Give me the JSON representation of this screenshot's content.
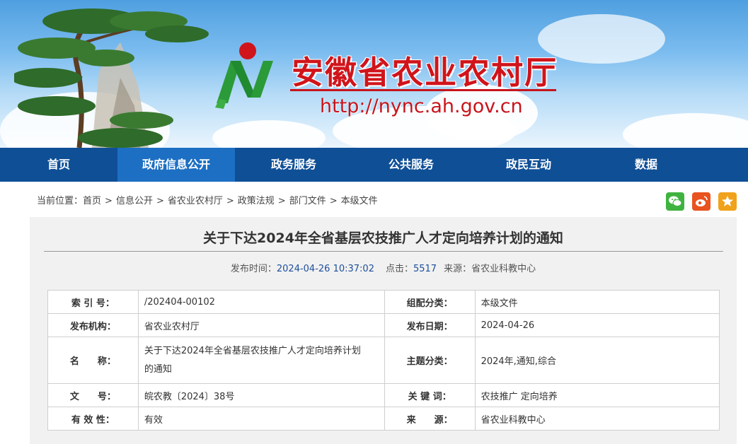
{
  "header": {
    "site_title": "安徽省农业农村厅",
    "site_url": "http://nync.ah.gov.cn",
    "logo_icon": "ministry-logo-icon",
    "colors": {
      "title_red": "#d0141b",
      "nav_blue": "#0f4f96",
      "nav_active": "#1d6fc3"
    }
  },
  "nav": {
    "items": [
      {
        "label": "首页"
      },
      {
        "label": "政府信息公开"
      },
      {
        "label": "政务服务"
      },
      {
        "label": "公共服务"
      },
      {
        "label": "政民互动"
      },
      {
        "label": "数据"
      }
    ],
    "active_index": 1
  },
  "breadcrumb": {
    "prefix": "当前位置：",
    "items": [
      "首页",
      "信息公开",
      "省农业农村厅",
      "政策法规",
      "部门文件",
      "本级文件"
    ],
    "separator": ">"
  },
  "share": {
    "icons": [
      "wechat-icon",
      "weibo-icon",
      "favorite-star-icon"
    ]
  },
  "article": {
    "title": "关于下达2024年全省基层农技推广人才定向培养计划的通知",
    "publish_label": "发布时间：",
    "publish_time": "2024-04-26 10:37:02",
    "clicks_label": "点击：",
    "clicks": "5517",
    "source_label": "来源：",
    "source": "省农业科教中心"
  },
  "info_table": {
    "index_label": "索 引 号：",
    "index_value": "/202404-00102",
    "category_label": "组配分类：",
    "category_value": "本级文件",
    "org_label": "发布机构：",
    "org_value": "省农业农村厅",
    "date_label": "发布日期：",
    "date_value": "2024-04-26",
    "name_label": "名　　称：",
    "name_value_line1": "关于下达2024年全省基层农技推广人才定向培养计划",
    "name_value_line2": "的通知",
    "topic_label": "主题分类：",
    "topic_value": "2024年,通知,综合",
    "docno_label": "文　　号：",
    "docno_value": "皖农教〔2024〕38号",
    "keywords_label": "关 键 词：",
    "keywords_value": "农技推广 定向培养",
    "validity_label": "有 效 性：",
    "validity_value": "有效",
    "source_label": "来　　源：",
    "source_value": "省农业科教中心"
  }
}
